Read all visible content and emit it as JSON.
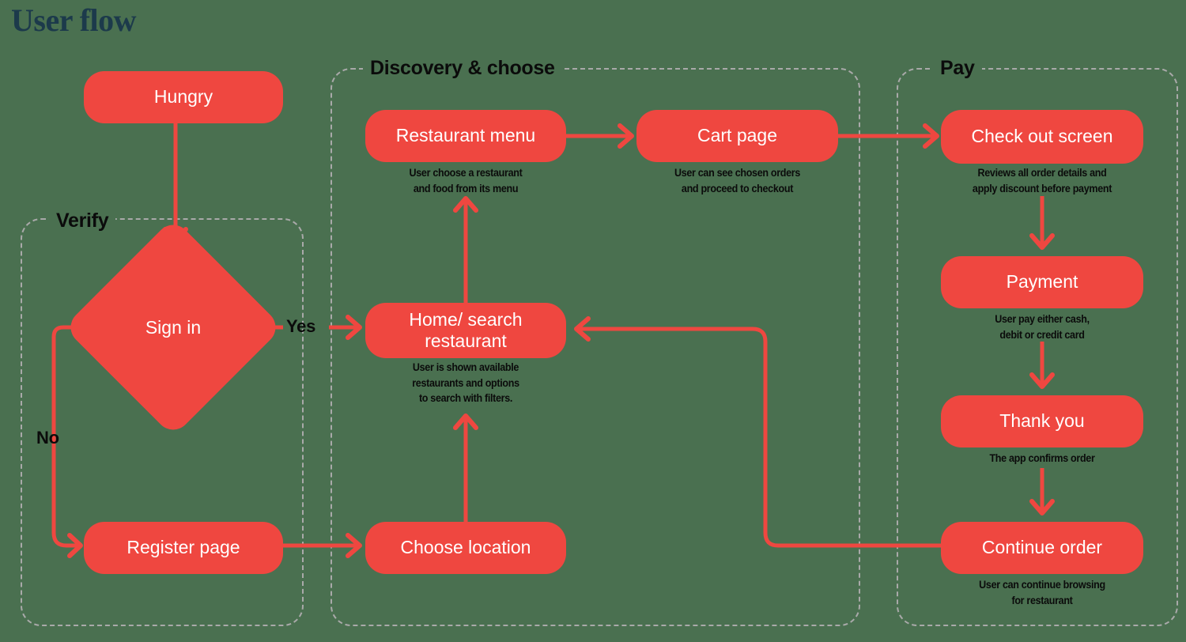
{
  "page": {
    "title": "User flow",
    "background_color": "#4a7050",
    "accent_color": "#ef4740",
    "title_color": "#1c3a4b",
    "group_border_color": "#a9a9a9"
  },
  "groups": [
    {
      "id": "verify",
      "label": "Verify"
    },
    {
      "id": "discovery",
      "label": "Discovery & choose"
    },
    {
      "id": "pay",
      "label": "Pay"
    }
  ],
  "nodes": [
    {
      "id": "hungry",
      "label": "Hungry",
      "caption": ""
    },
    {
      "id": "sign-in",
      "label": "Sign in",
      "caption": "",
      "shape": "diamond"
    },
    {
      "id": "register-page",
      "label": "Register page",
      "caption": ""
    },
    {
      "id": "restaurant-menu",
      "label": "Restaurant menu",
      "caption": "User choose a restaurant\nand food from its menu"
    },
    {
      "id": "cart-page",
      "label": "Cart page",
      "caption": "User can see chosen orders\nand proceed to checkout"
    },
    {
      "id": "home-search",
      "label": "Home/ search\nrestaurant",
      "caption": "User is shown available\nrestaurants and options\nto search with filters."
    },
    {
      "id": "choose-location",
      "label": "Choose location",
      "caption": ""
    },
    {
      "id": "check-out",
      "label": "Check out screen",
      "caption": "Reviews all order details and\napply discount before payment"
    },
    {
      "id": "payment",
      "label": "Payment",
      "caption": "User pay either cash,\ndebit or credit card"
    },
    {
      "id": "thank-you",
      "label": "Thank you",
      "caption": "The app confirms order"
    },
    {
      "id": "continue-order",
      "label": "Continue order",
      "caption": "User can continue browsing\nfor restaurant"
    }
  ],
  "edge_labels": {
    "yes": "Yes",
    "no": "No"
  }
}
